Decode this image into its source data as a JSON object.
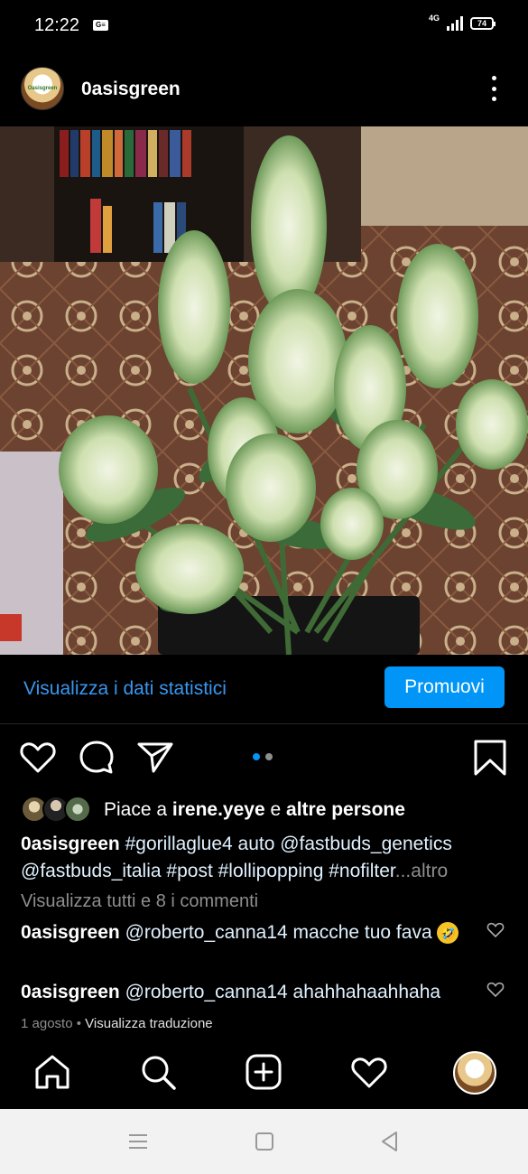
{
  "status_bar": {
    "time": "12:22",
    "app_badge": "G≡",
    "network": "4G",
    "battery": "74"
  },
  "post": {
    "username": "0asisgreen",
    "avatar_text": "Oasisgreen",
    "image_alt": "Cannabis plants in a pot on a patterned tile floor",
    "insights_label": "Visualizza i dati statistici",
    "promote_label": "Promuovi",
    "carousel": {
      "count": 2,
      "active": 1
    },
    "likes": {
      "prefix": "Piace a",
      "user": "irene.yeye",
      "conjunction": "e",
      "others": "altre persone"
    },
    "caption": {
      "username": "0asisgreen",
      "text": "#gorillaglue4 auto @fastbuds_genetics @fastbuds_italia #post #lollipopping #nofilter",
      "more": "...altro"
    },
    "view_all_comments": "Visualizza tutti e 8 i commenti",
    "comments": [
      {
        "username": "0asisgreen",
        "text": "@roberto_canna14 macche tuo fava",
        "emoji": "🤣"
      },
      {
        "username": "0asisgreen",
        "text": "@roberto_canna14 ahahhahaahhaha"
      }
    ],
    "date": "1 agosto",
    "separator": "•",
    "translate": "Visualizza traduzione"
  },
  "colors": {
    "accent": "#0095f6",
    "link": "#3897f0",
    "muted": "#8e8e8e",
    "background": "#000000"
  },
  "nav": [
    "home-icon",
    "search-icon",
    "new-post-icon",
    "activity-icon",
    "profile-avatar"
  ],
  "system_nav": [
    "menu-icon",
    "home-square-icon",
    "back-triangle-icon"
  ]
}
